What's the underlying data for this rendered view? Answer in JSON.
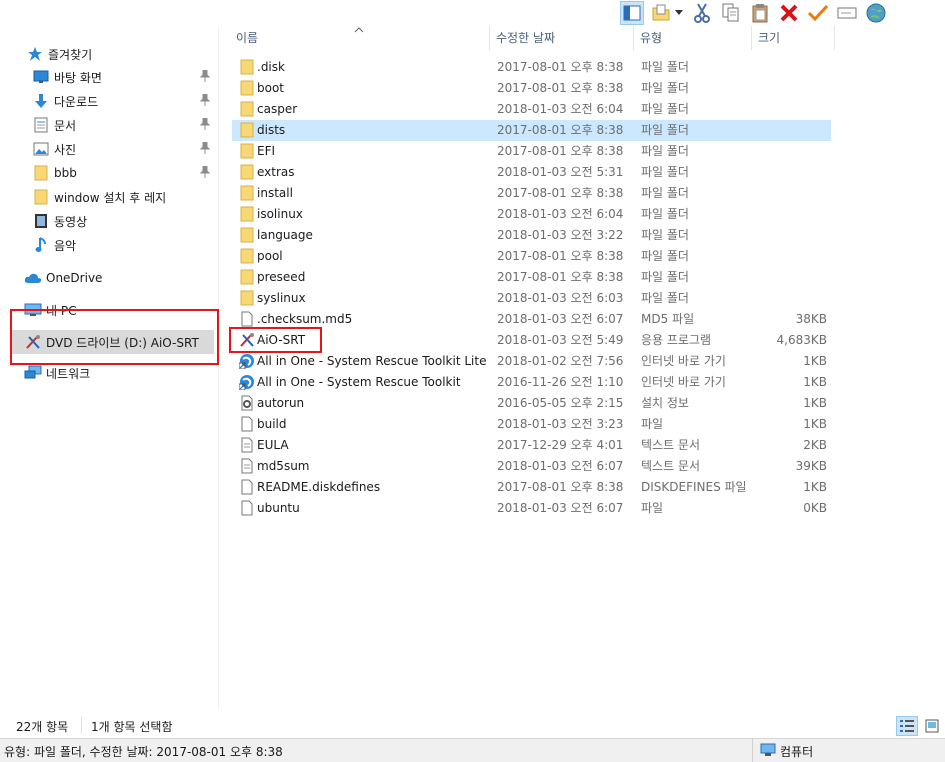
{
  "toolbar": {
    "icons": [
      "layout-pane-icon",
      "new-item-icon",
      "dropdown-arrow-icon",
      "cut-icon",
      "copy-icon",
      "paste-icon",
      "delete-icon",
      "checkmark-icon",
      "rename-icon",
      "globe-icon"
    ]
  },
  "nav": {
    "quick_access": "즐겨찾기",
    "items": [
      {
        "label": "바탕 화면",
        "icon": "desktop-icon",
        "pinned": true
      },
      {
        "label": "다운로드",
        "icon": "download-icon",
        "pinned": true
      },
      {
        "label": "문서",
        "icon": "document-icon",
        "pinned": true
      },
      {
        "label": "사진",
        "icon": "picture-icon",
        "pinned": true
      },
      {
        "label": "bbb",
        "icon": "folder-icon",
        "pinned": true
      },
      {
        "label": "window 설치 후 레지",
        "icon": "folder-icon",
        "pinned": false
      },
      {
        "label": "동영상",
        "icon": "video-icon",
        "pinned": false
      },
      {
        "label": "음악",
        "icon": "music-icon",
        "pinned": false
      }
    ],
    "onedrive": "OneDrive",
    "thispc": "내 PC",
    "dvd": "DVD 드라이브 (D:) AiO-SRT",
    "network": "네트워크"
  },
  "columns": {
    "name": "이름",
    "date": "수정한 날짜",
    "type": "유형",
    "size": "크기"
  },
  "files": [
    {
      "name": ".disk",
      "date": "2017-08-01 오후 8:38",
      "type": "파일 폴더",
      "size": "",
      "icon": "folder"
    },
    {
      "name": "boot",
      "date": "2017-08-01 오후 8:38",
      "type": "파일 폴더",
      "size": "",
      "icon": "folder"
    },
    {
      "name": "casper",
      "date": "2018-01-03 오전 6:04",
      "type": "파일 폴더",
      "size": "",
      "icon": "folder"
    },
    {
      "name": "dists",
      "date": "2017-08-01 오후 8:38",
      "type": "파일 폴더",
      "size": "",
      "icon": "folder",
      "selected": true
    },
    {
      "name": "EFI",
      "date": "2017-08-01 오후 8:38",
      "type": "파일 폴더",
      "size": "",
      "icon": "folder"
    },
    {
      "name": "extras",
      "date": "2018-01-03 오전 5:31",
      "type": "파일 폴더",
      "size": "",
      "icon": "folder"
    },
    {
      "name": "install",
      "date": "2017-08-01 오후 8:38",
      "type": "파일 폴더",
      "size": "",
      "icon": "folder"
    },
    {
      "name": "isolinux",
      "date": "2018-01-03 오전 6:04",
      "type": "파일 폴더",
      "size": "",
      "icon": "folder"
    },
    {
      "name": "language",
      "date": "2018-01-03 오전 3:22",
      "type": "파일 폴더",
      "size": "",
      "icon": "folder"
    },
    {
      "name": "pool",
      "date": "2017-08-01 오후 8:38",
      "type": "파일 폴더",
      "size": "",
      "icon": "folder"
    },
    {
      "name": "preseed",
      "date": "2017-08-01 오후 8:38",
      "type": "파일 폴더",
      "size": "",
      "icon": "folder"
    },
    {
      "name": "syslinux",
      "date": "2018-01-03 오전 6:03",
      "type": "파일 폴더",
      "size": "",
      "icon": "folder"
    },
    {
      "name": ".checksum.md5",
      "date": "2018-01-03 오전 6:07",
      "type": "MD5 파일",
      "size": "38KB",
      "icon": "file"
    },
    {
      "name": "AiO-SRT",
      "date": "2018-01-03 오전 5:49",
      "type": "응용 프로그램",
      "size": "4,683KB",
      "icon": "app"
    },
    {
      "name": "All in One - System Rescue Toolkit Lite",
      "date": "2018-01-02 오전 7:56",
      "type": "인터넷 바로 가기",
      "size": "1KB",
      "icon": "shortcut"
    },
    {
      "name": "All in One - System Rescue Toolkit",
      "date": "2016-11-26 오전 1:10",
      "type": "인터넷 바로 가기",
      "size": "1KB",
      "icon": "shortcut"
    },
    {
      "name": "autorun",
      "date": "2016-05-05 오후 2:15",
      "type": "설치 정보",
      "size": "1KB",
      "icon": "settings"
    },
    {
      "name": "build",
      "date": "2018-01-03 오전 3:23",
      "type": "파일",
      "size": "1KB",
      "icon": "file"
    },
    {
      "name": "EULA",
      "date": "2017-12-29 오후 4:01",
      "type": "텍스트 문서",
      "size": "2KB",
      "icon": "text"
    },
    {
      "name": "md5sum",
      "date": "2018-01-03 오전 6:07",
      "type": "텍스트 문서",
      "size": "39KB",
      "icon": "text"
    },
    {
      "name": "README.diskdefines",
      "date": "2017-08-01 오후 8:38",
      "type": "DISKDEFINES 파일",
      "size": "1KB",
      "icon": "file"
    },
    {
      "name": "ubuntu",
      "date": "2018-01-03 오전 6:07",
      "type": "파일",
      "size": "0KB",
      "icon": "file"
    }
  ],
  "status": {
    "count": "22개 항목",
    "selected": "1개 항목 선택함",
    "detail": "유형: 파일 폴더, 수정한 날짜: 2017-08-01 오후 8:38",
    "location": "컴퓨터"
  },
  "colors": {
    "selection": "#cce8ff",
    "highlight_box": "#e8141c",
    "folder": "#f8d775",
    "nav_selected": "#d9d9d9"
  }
}
